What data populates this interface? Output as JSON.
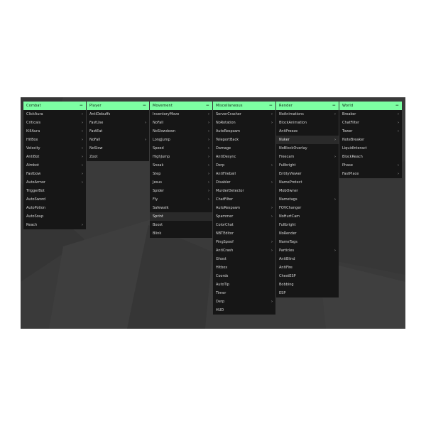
{
  "colors": {
    "header_bg": "#7dffa3",
    "panel_bg": "#161616",
    "screen_bg": "#3a3a3a",
    "text": "#d6d6d6"
  },
  "icons": {
    "collapse": "minus-icon",
    "submenu": "chevron-right-icon"
  },
  "menus": [
    {
      "title": "Combat",
      "items": [
        {
          "label": "ClickAura",
          "sub": true
        },
        {
          "label": "Criticals",
          "sub": true
        },
        {
          "label": "KillAura",
          "sub": true
        },
        {
          "label": "HitBox",
          "sub": true
        },
        {
          "label": "Velocity",
          "sub": true
        },
        {
          "label": "AntiBot",
          "sub": true
        },
        {
          "label": "Aimbot",
          "sub": true
        },
        {
          "label": "Fastbow",
          "sub": true
        },
        {
          "label": "AutoArmor",
          "sub": true
        },
        {
          "label": "TriggerBot",
          "sub": false
        },
        {
          "label": "AutoSword",
          "sub": false
        },
        {
          "label": "AutoPotion",
          "sub": false
        },
        {
          "label": "AutoSoup",
          "sub": false
        },
        {
          "label": "Reach",
          "sub": true
        }
      ]
    },
    {
      "title": "Player",
      "items": [
        {
          "label": "AntiDebuffs",
          "sub": false
        },
        {
          "label": "FastUse",
          "sub": true
        },
        {
          "label": "FastEat",
          "sub": false
        },
        {
          "label": "NoFall",
          "sub": true
        },
        {
          "label": "NoSlow",
          "sub": false
        },
        {
          "label": "Zoot",
          "sub": false
        }
      ]
    },
    {
      "title": "Movement",
      "items": [
        {
          "label": "InventoryMove",
          "sub": true
        },
        {
          "label": "NoFall",
          "sub": true
        },
        {
          "label": "NoSlowdown",
          "sub": true
        },
        {
          "label": "LongJump",
          "sub": true
        },
        {
          "label": "Speed",
          "sub": true
        },
        {
          "label": "HighJump",
          "sub": true
        },
        {
          "label": "Sneak",
          "sub": true
        },
        {
          "label": "Step",
          "sub": true
        },
        {
          "label": "Jesus",
          "sub": true
        },
        {
          "label": "Spider",
          "sub": true
        },
        {
          "label": "Fly",
          "sub": true
        },
        {
          "label": "Safewalk",
          "sub": false
        },
        {
          "label": "Sprint",
          "sub": false,
          "hl": true
        },
        {
          "label": "Boost",
          "sub": false
        },
        {
          "label": "Blink",
          "sub": false
        }
      ]
    },
    {
      "title": "Miscellaneous",
      "items": [
        {
          "label": "ServerCrasher",
          "sub": true
        },
        {
          "label": "NoRotation",
          "sub": true
        },
        {
          "label": "AutoRespawn",
          "sub": false
        },
        {
          "label": "TeleportBack",
          "sub": false
        },
        {
          "label": "Damage",
          "sub": false
        },
        {
          "label": "AntiDesync",
          "sub": false
        },
        {
          "label": "Derp",
          "sub": true
        },
        {
          "label": "AntiFireball",
          "sub": false
        },
        {
          "label": "Disabler",
          "sub": true
        },
        {
          "label": "MurderDetector",
          "sub": false
        },
        {
          "label": "ChatFilter",
          "sub": false
        },
        {
          "label": "AutoRespawn",
          "sub": true
        },
        {
          "label": "Spammer",
          "sub": true
        },
        {
          "label": "ColorChat",
          "sub": false
        },
        {
          "label": "NBTEditor",
          "sub": false
        },
        {
          "label": "PingSpoof",
          "sub": true
        },
        {
          "label": "AntiCrash",
          "sub": true
        },
        {
          "label": "Ghost",
          "sub": false
        },
        {
          "label": "Hitbox",
          "sub": false
        },
        {
          "label": "Coords",
          "sub": false
        },
        {
          "label": "AutoTip",
          "sub": false
        },
        {
          "label": "Timer",
          "sub": false
        },
        {
          "label": "Derp",
          "sub": true
        },
        {
          "label": "HUD",
          "sub": false
        }
      ]
    },
    {
      "title": "Render",
      "items": [
        {
          "label": "NoAnimations",
          "sub": true
        },
        {
          "label": "BlockAnimation",
          "sub": false
        },
        {
          "label": "AntiFreeze",
          "sub": false
        },
        {
          "label": "Nuker",
          "sub": true,
          "hl": true
        },
        {
          "label": "NoBlockOverlay",
          "sub": false
        },
        {
          "label": "Freecam",
          "sub": true
        },
        {
          "label": "Fullbright",
          "sub": false
        },
        {
          "label": "EntityViewer",
          "sub": false
        },
        {
          "label": "NameProtect",
          "sub": false
        },
        {
          "label": "MobOwner",
          "sub": false
        },
        {
          "label": "Nametags",
          "sub": true
        },
        {
          "label": "FOVChanger",
          "sub": false
        },
        {
          "label": "NoHurtCam",
          "sub": false
        },
        {
          "label": "Fullbright",
          "sub": false
        },
        {
          "label": "NoRender",
          "sub": false
        },
        {
          "label": "NameTags",
          "sub": false
        },
        {
          "label": "Particles",
          "sub": true
        },
        {
          "label": "AntiBlind",
          "sub": false
        },
        {
          "label": "AntiFire",
          "sub": false
        },
        {
          "label": "ChestESP",
          "sub": false
        },
        {
          "label": "Bobbing",
          "sub": false
        },
        {
          "label": "ESP",
          "sub": false
        }
      ]
    },
    {
      "title": "World",
      "items": [
        {
          "label": "Breaker",
          "sub": true
        },
        {
          "label": "ChatFilter",
          "sub": true
        },
        {
          "label": "Tower",
          "sub": true
        },
        {
          "label": "NoteBreaker",
          "sub": false
        },
        {
          "label": "LiquidInteract",
          "sub": false
        },
        {
          "label": "BlockReach",
          "sub": false
        },
        {
          "label": "Phase",
          "sub": true
        },
        {
          "label": "FastPlace",
          "sub": true
        }
      ]
    }
  ]
}
